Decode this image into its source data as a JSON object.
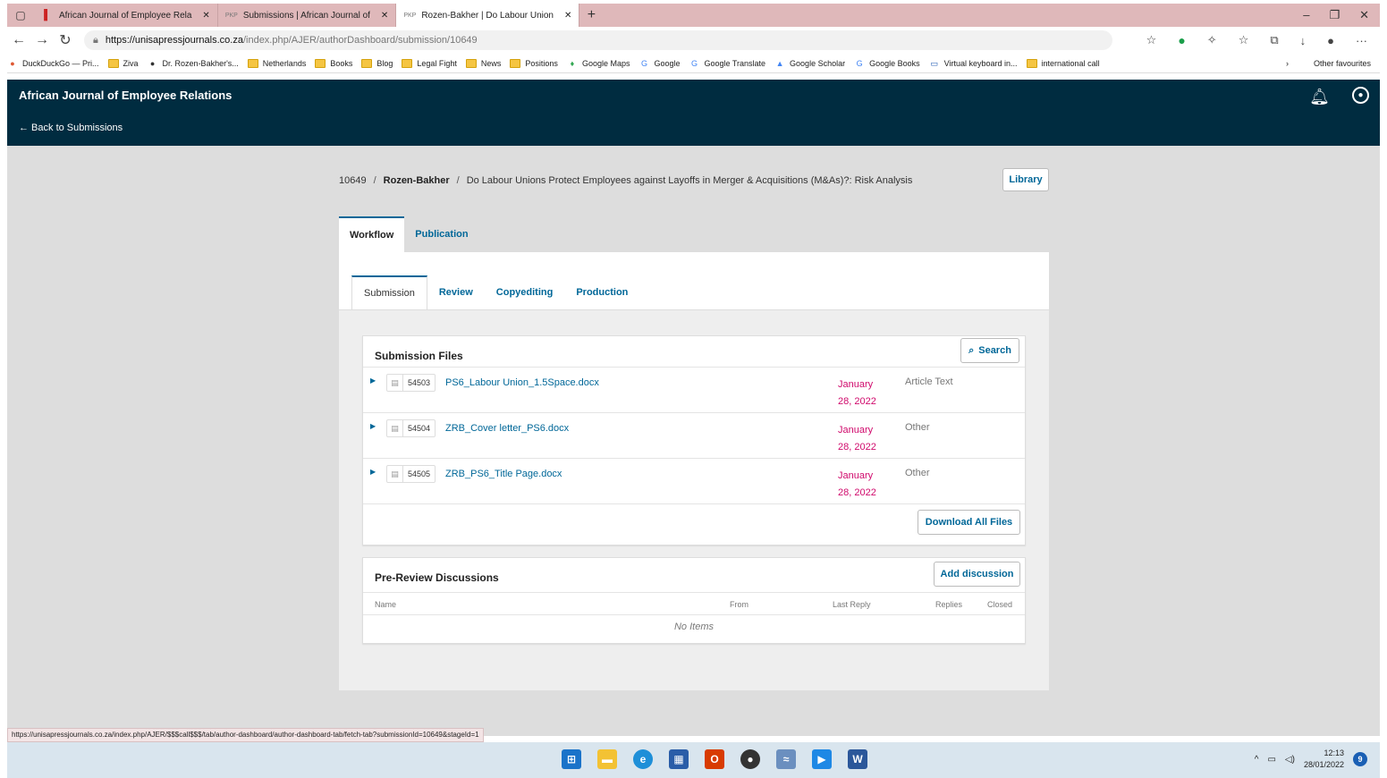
{
  "browser": {
    "tabs": [
      {
        "title": "African Journal of Employee Rela",
        "active": false,
        "favicon": "red-flag-icon"
      },
      {
        "title": "Submissions | African Journal of",
        "active": false,
        "favicon": "pkp-icon"
      },
      {
        "title": "Rozen-Bakher | Do Labour Union",
        "active": true,
        "favicon": "pkp-icon"
      }
    ],
    "url_host": "https://unisapressjournals.co.za",
    "url_path": "/index.php/AJER/authorDashboard/submission/10649",
    "bookmarks": [
      "DuckDuckGo — Pri...",
      "Ziva",
      "Dr. Rozen-Bakher's...",
      "Netherlands",
      "Books",
      "Blog",
      "Legal Fight",
      "News",
      "Positions",
      "Google Maps",
      "Google",
      "Google Translate",
      "Google Scholar",
      "Google Books",
      "Virtual keyboard in...",
      "international call"
    ],
    "other_favourites": "Other favourites",
    "status_url": "https://unisapressjournals.co.za/index.php/AJER/$$$call$$$/tab/author-dashboard/author-dashboard-tab/fetch-tab?submissionId=10649&stageId=1"
  },
  "header": {
    "journal": "African Journal of Employee Relations",
    "back": "← Back to Submissions"
  },
  "breadcrumb": {
    "id": "10649",
    "sep": "/",
    "author": "Rozen-Bakher",
    "title": "Do Labour Unions Protect Employees against Layoffs in Merger & Acquisitions (M&As)?: Risk Analysis"
  },
  "library_label": "Library",
  "main_tabs": {
    "workflow": "Workflow",
    "publication": "Publication"
  },
  "sub_tabs": {
    "submission": "Submission",
    "review": "Review",
    "copyediting": "Copyediting",
    "production": "Production"
  },
  "files": {
    "title": "Submission Files",
    "search_label": "Search",
    "rows": [
      {
        "id": "54503",
        "name": "PS6_Labour Union_1.5Space.docx",
        "date1": "January",
        "date2": "28, 2022",
        "type": "Article Text"
      },
      {
        "id": "54504",
        "name": "ZRB_Cover letter_PS6.docx",
        "date1": "January",
        "date2": "28, 2022",
        "type": "Other"
      },
      {
        "id": "54505",
        "name": "ZRB_PS6_Title Page.docx",
        "date1": "January",
        "date2": "28, 2022",
        "type": "Other"
      }
    ],
    "download_all": "Download All Files"
  },
  "discussions": {
    "title": "Pre-Review Discussions",
    "add_label": "Add discussion",
    "columns": {
      "name": "Name",
      "from": "From",
      "last_reply": "Last Reply",
      "replies": "Replies",
      "closed": "Closed"
    },
    "empty": "No Items"
  },
  "taskbar": {
    "time": "12:13",
    "date": "28/01/2022",
    "notifications": "9"
  },
  "colors": {
    "header_bg": "#002c40",
    "link": "#006798",
    "date": "#d00a6c"
  }
}
